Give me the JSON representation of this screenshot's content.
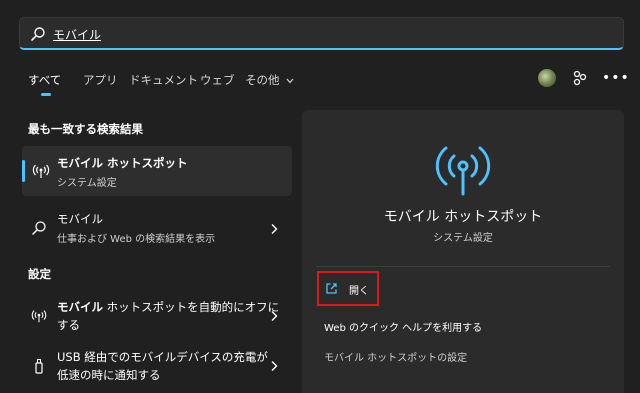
{
  "search": {
    "value": "モバイル"
  },
  "tabs": [
    {
      "label": "すべて",
      "active": true
    },
    {
      "label": "アプリ"
    },
    {
      "label": "ドキュメント"
    },
    {
      "label": "ウェブ"
    },
    {
      "label": "その他"
    }
  ],
  "sections": {
    "best_match": "最も一致する検索結果",
    "settings": "設定"
  },
  "best_match": {
    "title": "モバイル ホットスポット",
    "subtitle": "システム設定"
  },
  "web_result": {
    "title": "モバイル",
    "subtitle": "仕事および Web の検索結果を表示"
  },
  "settings_results": [
    {
      "title_bold": "モバイル",
      "title_rest": " ホットスポットを自動的にオフに",
      "line2": "する"
    },
    {
      "title": "USB 経由でのモバイルデバイスの充電が",
      "line2": "低速の時に通知する"
    }
  ],
  "detail": {
    "title": "モバイル ホットスポット",
    "subtitle": "システム設定",
    "open_label": "開く",
    "actions": [
      "Web のクイック ヘルプを利用する",
      "モバイル ホットスポットの設定"
    ]
  },
  "colors": {
    "accent": "#4cc2ff",
    "highlight_border": "#e0161b",
    "background": "#202020",
    "panel": "#2b2b2b"
  },
  "icons": [
    "search-icon",
    "hotspot-icon",
    "external-link-icon",
    "chevron-right-icon",
    "share-icon",
    "more-icon",
    "usb-device-icon"
  ]
}
